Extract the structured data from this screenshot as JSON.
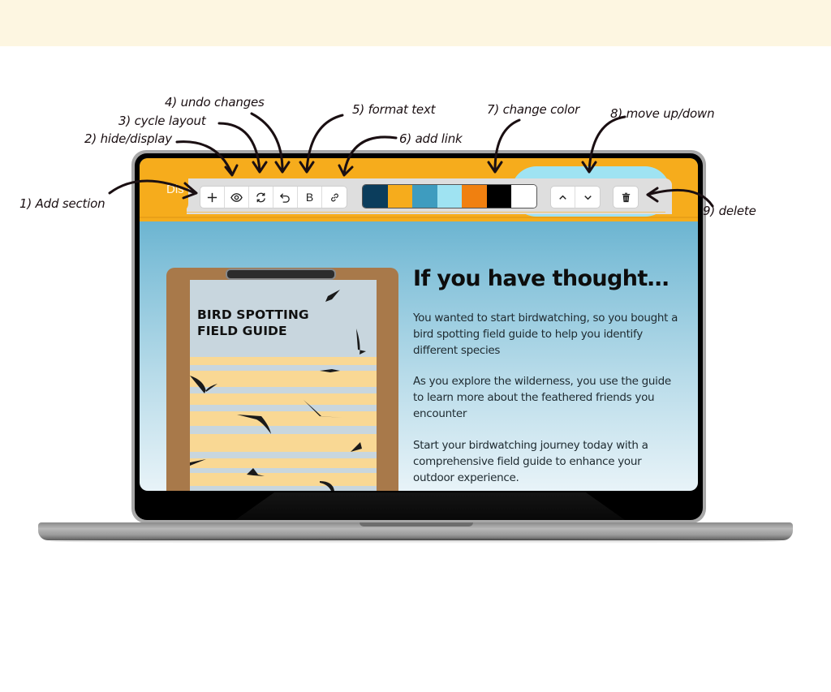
{
  "annotations": [
    {
      "id": "add-section",
      "text": "1) Add section"
    },
    {
      "id": "hide-display",
      "text": "2) hide/display"
    },
    {
      "id": "cycle-layout",
      "text": "3) cycle layout"
    },
    {
      "id": "undo-changes",
      "text": "4) undo changes"
    },
    {
      "id": "format-text",
      "text": "5) format text"
    },
    {
      "id": "add-link",
      "text": "6) add link"
    },
    {
      "id": "change-color",
      "text": "7) change color"
    },
    {
      "id": "move-up-down",
      "text": "8) move up/down"
    },
    {
      "id": "delete",
      "text": "9) delete"
    }
  ],
  "header": {
    "label_partial": "Dis",
    "accent_color": "#f6ac1c",
    "blob_color": "#9fe3f2"
  },
  "toolbar": {
    "edit_buttons": [
      {
        "icon": "plus-icon",
        "label": "Add section"
      },
      {
        "icon": "eye-icon",
        "label": "Hide/display"
      },
      {
        "icon": "cycle-icon",
        "label": "Cycle layout"
      },
      {
        "icon": "undo-icon",
        "label": "Undo changes"
      },
      {
        "icon": "bold-icon",
        "label": "Format text",
        "glyph": "B"
      },
      {
        "icon": "link-icon",
        "label": "Add link"
      }
    ],
    "color_swatches": [
      "#0b3d5c",
      "#f6ac1c",
      "#3e9cbf",
      "#9fe3f2",
      "#f08010",
      "#000000",
      "#ffffff"
    ],
    "move_buttons": [
      {
        "icon": "chevron-up-icon",
        "label": "Move up"
      },
      {
        "icon": "chevron-down-icon",
        "label": "Move down"
      }
    ],
    "delete_button": {
      "icon": "trash-icon",
      "label": "Delete"
    }
  },
  "content": {
    "book_title_line1": "BIRD SPOTTING",
    "book_title_line2": "FIELD GUIDE",
    "headline": "If you have thought…",
    "paragraphs": [
      "You wanted to start birdwatching, so you bought a bird spotting field guide to help you identify different species",
      "As you explore the wilderness, you use the guide to learn more about the feathered friends you encounter",
      "Start your birdwatching journey today with a comprehensive field guide to enhance your outdoor experience."
    ]
  }
}
